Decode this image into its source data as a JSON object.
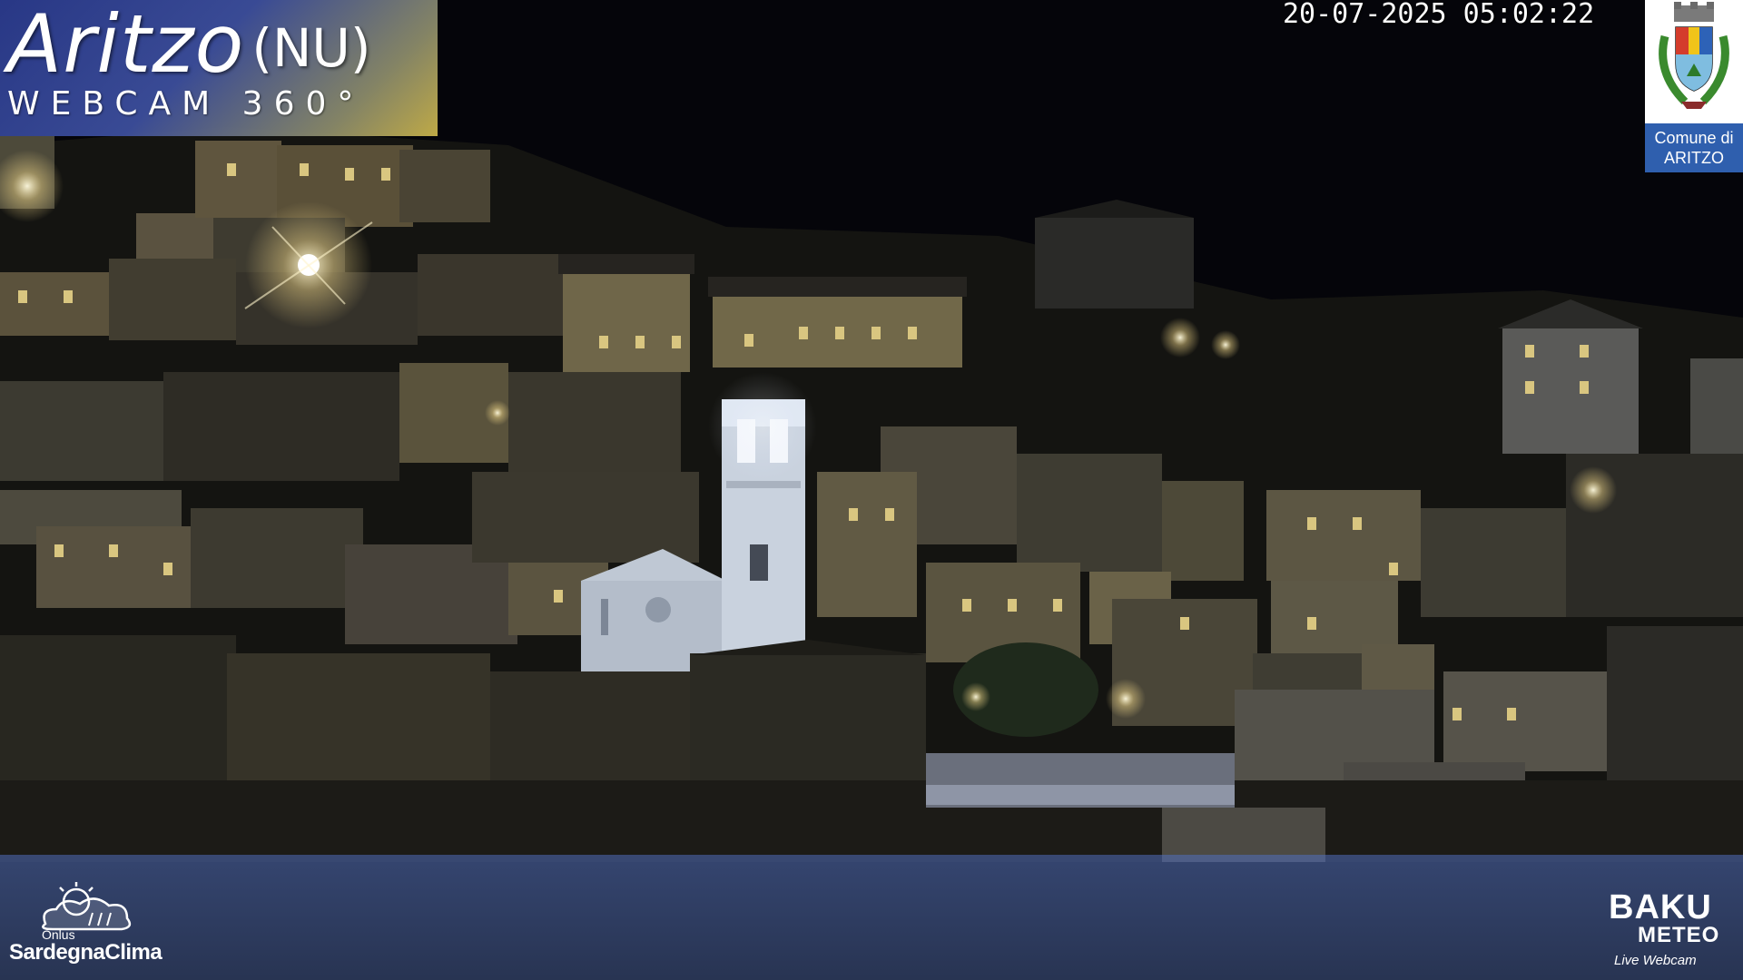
{
  "overlay": {
    "title": "Aritzo",
    "region": "(NU)",
    "subtitle": "WEBCAM 360°",
    "timestamp": "20-07-2025 05:02:22"
  },
  "crest": {
    "label_line1": "Comune di",
    "label_line2": "ARITZO"
  },
  "logos": {
    "left": {
      "small": "Onlus",
      "brand": "SardegnaClima"
    },
    "right": {
      "brand": "BAKU",
      "sub": "METEO",
      "tagline": "Live Webcam"
    }
  },
  "colors": {
    "night_sky": "#05050a",
    "window_glow": "#e8d99a",
    "bell_tower": "#d8e0ec",
    "banner_blue": "#3c4e9c",
    "banner_gold": "#c8b24a",
    "crest_label_blue": "#2f5fae"
  }
}
